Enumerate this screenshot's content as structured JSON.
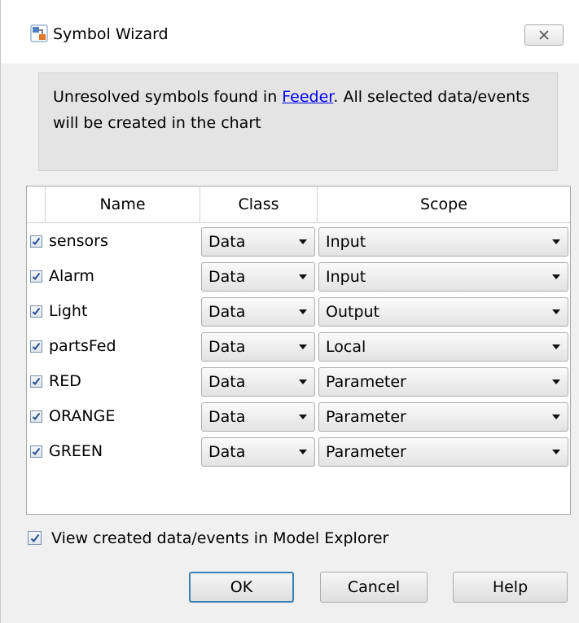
{
  "window": {
    "title": "Symbol Wizard",
    "close_icon": "close-x-icon",
    "app_icon": "simulink-icon"
  },
  "message": {
    "prefix": "Unresolved symbols found in ",
    "link": "Feeder",
    "suffix": ". All selected data/events will be created in the chart"
  },
  "table": {
    "headers": [
      "Name",
      "Class",
      "Scope"
    ],
    "rows": [
      {
        "checked": true,
        "name": "sensors",
        "class": "Data",
        "scope": "Input"
      },
      {
        "checked": true,
        "name": "Alarm",
        "class": "Data",
        "scope": "Input"
      },
      {
        "checked": true,
        "name": "Light",
        "class": "Data",
        "scope": "Output"
      },
      {
        "checked": true,
        "name": "partsFed",
        "class": "Data",
        "scope": "Local"
      },
      {
        "checked": true,
        "name": "RED",
        "class": "Data",
        "scope": "Parameter"
      },
      {
        "checked": true,
        "name": "ORANGE",
        "class": "Data",
        "scope": "Parameter"
      },
      {
        "checked": true,
        "name": "GREEN",
        "class": "Data",
        "scope": "Parameter"
      }
    ]
  },
  "view_in_explorer": {
    "checked": true,
    "label": "View created data/events in Model Explorer"
  },
  "buttons": {
    "ok": "OK",
    "cancel": "Cancel",
    "help": "Help"
  },
  "colors": {
    "link": "#0000ee",
    "ok_border": "#3c7fb1",
    "check": "#2a4d8f"
  }
}
